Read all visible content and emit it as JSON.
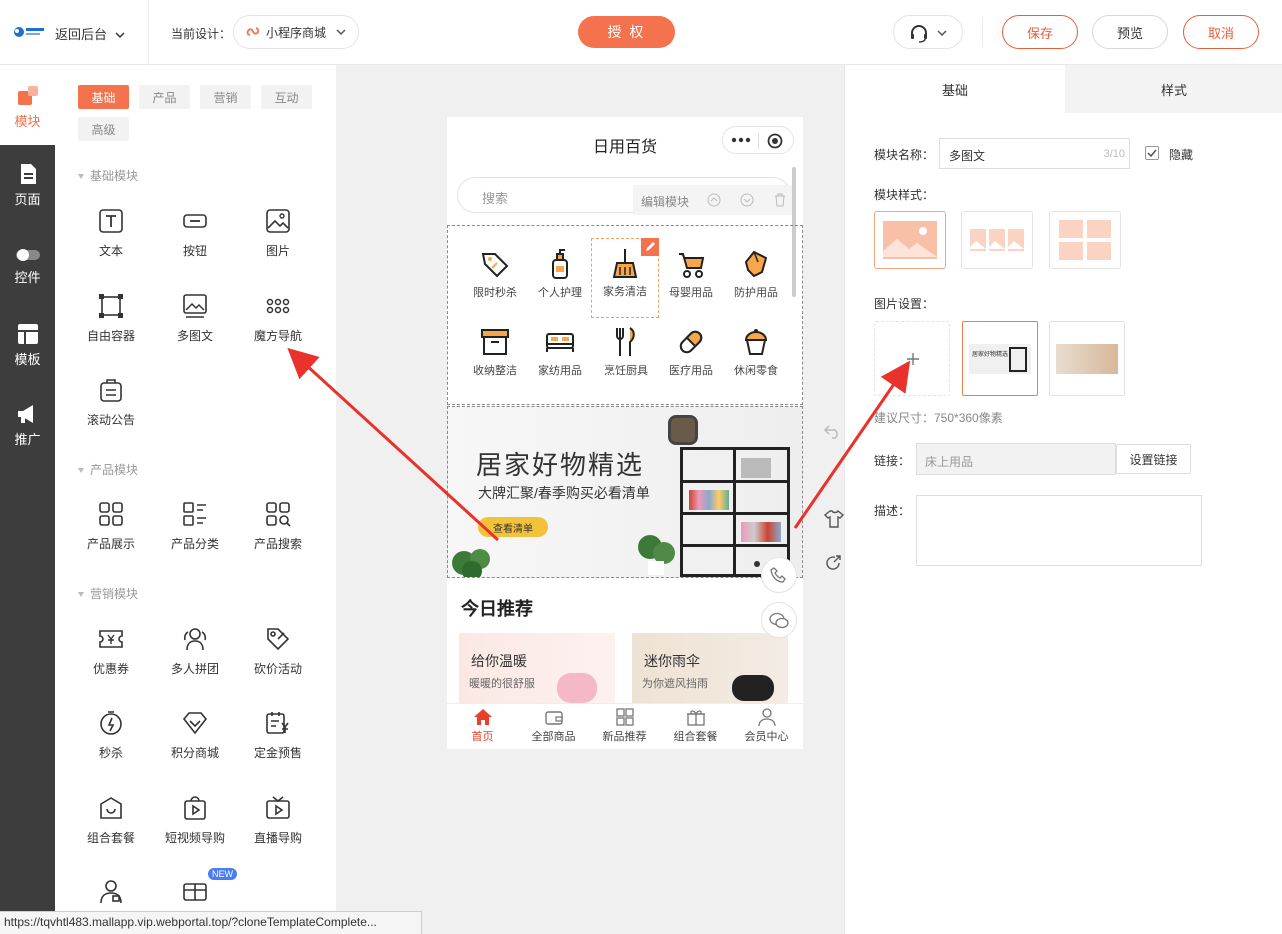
{
  "topbar": {
    "back_label": "返回后台",
    "current_design_label": "当前设计：",
    "design_name": "小程序商城",
    "authorize_label": "授 权",
    "save_label": "保存",
    "preview_label": "预览",
    "cancel_label": "取消"
  },
  "nav": {
    "items": [
      {
        "label": "模块",
        "icon": "module-icon"
      },
      {
        "label": "页面",
        "icon": "page-icon"
      },
      {
        "label": "控件",
        "icon": "toggle-icon"
      },
      {
        "label": "模板",
        "icon": "template-icon"
      },
      {
        "label": "推广",
        "icon": "megaphone-icon"
      }
    ]
  },
  "panel": {
    "tags": [
      "基础",
      "产品",
      "营销",
      "互动",
      "高级"
    ],
    "sections": {
      "basic": "基础模块",
      "product": "产品模块",
      "marketing": "营销模块"
    },
    "basic_modules": [
      "文本",
      "按钮",
      "图片",
      "自由容器",
      "多图文",
      "魔方导航",
      "滚动公告"
    ],
    "product_modules": [
      "产品展示",
      "产品分类",
      "产品搜索"
    ],
    "marketing_modules": [
      "优惠券",
      "多人拼团",
      "砍价活动",
      "秒杀",
      "积分商城",
      "定金预售",
      "组合套餐",
      "短视频导购",
      "直播导购"
    ],
    "new_badge": "NEW"
  },
  "phone": {
    "title": "日用百货",
    "search_placeholder": "搜索",
    "edit_module_label": "编辑模块",
    "grid_items": [
      "限时秒杀",
      "个人护理",
      "家务清洁",
      "母婴用品",
      "防护用品",
      "收纳整洁",
      "家纺用品",
      "烹饪厨具",
      "医疗用品",
      "休闲零食"
    ],
    "banner": {
      "title": "居家好物精选",
      "subtitle": "大牌汇聚/春季购买必看清单",
      "button": "查看清单"
    },
    "recommend_title": "今日推荐",
    "cards": [
      {
        "title": "给你温暖",
        "sub": "暖暖的很舒服"
      },
      {
        "title": "迷你雨伞",
        "sub": "为你遮风挡雨"
      }
    ],
    "tabs": [
      "首页",
      "全部商品",
      "新品推荐",
      "组合套餐",
      "会员中心"
    ]
  },
  "right": {
    "tabs": [
      "基础",
      "样式"
    ],
    "module_name_label": "模块名称：",
    "module_name_value": "多图文",
    "module_name_count": "3/10",
    "hide_label": "隐藏",
    "module_style_label": "模块样式：",
    "image_settings_label": "图片设置：",
    "size_hint": "建议尺寸：750*360像素",
    "link_label": "链接：",
    "link_value": "床上用品",
    "set_link_label": "设置链接",
    "desc_label": "描述：",
    "thumb_text": "居家好物精选"
  },
  "status_url": "https://tqvhtl483.mallapp.vip.webportal.top/?cloneTemplateComplete...",
  "colors": {
    "accent": "#f4734e",
    "nav_bg": "#3d3d3d",
    "arrow": "#e8322b"
  }
}
